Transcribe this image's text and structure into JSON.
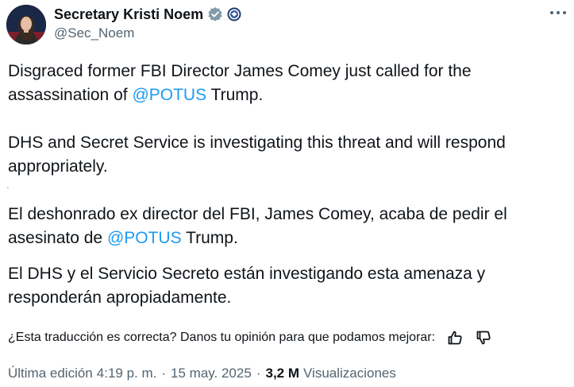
{
  "author": {
    "name": "Secretary Kristi Noem",
    "handle": "@Sec_Noem",
    "verified_badge_icon": "gray-verified-badge-icon",
    "affiliate_icon": "dhs-seal-icon"
  },
  "tweet": {
    "p1_before": "Disgraced former FBI Director James Comey just called for the assassination of ",
    "p1_mention": "@POTUS",
    "p1_after": " Trump.",
    "p2": "DHS and Secret Service is investigating this threat and will respond appropriately.",
    "p3_before": "El deshonrado ex director del FBI, James Comey, acaba de pedir el asesinato de ",
    "p3_mention": "@POTUS",
    "p3_after": " Trump.",
    "p4": "El DHS y el Servicio Secreto están investigando esta amenaza y responderán apropiadamente."
  },
  "translation_feedback": {
    "prompt": "¿Esta traducción es correcta? Danos tu opinión para que podamos mejorar:"
  },
  "meta": {
    "edited_label": "Última edición",
    "time": "4:19 p. m.",
    "date": "15 may. 2025",
    "separator": "·",
    "views_count": "3,2 M",
    "views_label": "Visualizaciones"
  },
  "colors": {
    "link": "#1d9bf0",
    "text": "#0f1419",
    "secondary": "#536471"
  }
}
